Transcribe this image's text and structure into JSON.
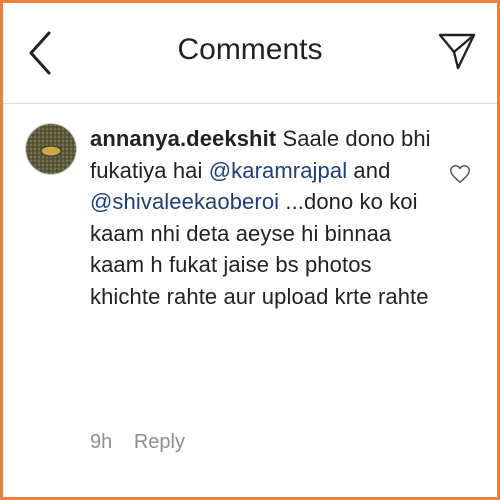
{
  "header": {
    "title": "Comments",
    "back_icon": "chevron-left-icon",
    "action_icon": "direct-send-icon"
  },
  "comment": {
    "username": "annanya.deekshit",
    "text_1": "Saale dono bhi fukatiya hai",
    "mention_1": "@karamrajpal",
    "text_2": "and",
    "mention_2": "@shivaleekaoberoi",
    "text_3": "...dono ko koi  kaam nhi deta aeyse hi binnaa kaam h fukat jaise bs photos khichte rahte aur upload krte rahte",
    "time": "9h",
    "reply_label": "Reply",
    "like_icon": "heart-outline-icon"
  },
  "colors": {
    "border": "#e8823a",
    "mention": "#1f3f73",
    "meta": "#8e8e8e"
  }
}
